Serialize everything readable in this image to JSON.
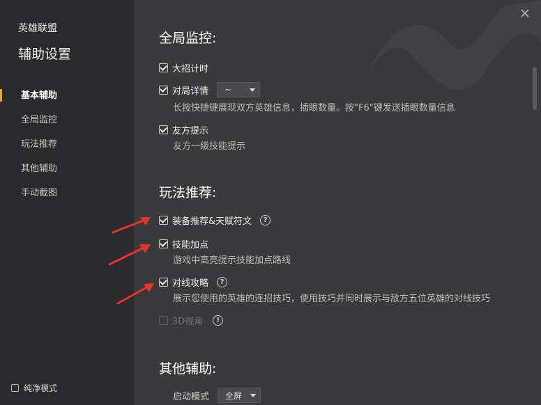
{
  "sidebar": {
    "app_name": "英雄联盟",
    "page_title": "辅助设置",
    "items": [
      {
        "label": "基本辅助",
        "active": true
      },
      {
        "label": "全局监控"
      },
      {
        "label": "玩法推荐"
      },
      {
        "label": "其他辅助"
      },
      {
        "label": "手动截图"
      }
    ],
    "pure_mode_label": "纯净模式",
    "accent_color": "#f2a21a"
  },
  "sections": {
    "global_monitor": {
      "title": "全局监控:",
      "ult_timer": {
        "label": "大招计时",
        "checked": true
      },
      "match_detail": {
        "label": "对局详情",
        "checked": true,
        "dropdown_value": "~",
        "desc": "长按快捷键展现双方英雄信息，插眼数量。按\"F6\"键发送插眼数量信息"
      },
      "ally_hint": {
        "label": "友方提示",
        "checked": true,
        "desc": "友方一级技能提示"
      }
    },
    "gameplay": {
      "title": "玩法推荐:",
      "equip_rune": {
        "label": "装备推荐&天赋符文",
        "checked": true,
        "help": "?"
      },
      "skill_points": {
        "label": "技能加点",
        "checked": true,
        "desc": "游戏中高亮提示技能加点路线"
      },
      "lane_guide": {
        "label": "对线攻略",
        "checked": true,
        "help": "?",
        "desc": "展示您使用的英雄的连招技巧，使用技巧并同时展示与敌方五位英雄的对线技巧"
      },
      "view_3d": {
        "label": "3D视角",
        "checked": false,
        "disabled": true,
        "info": "!"
      }
    },
    "other": {
      "title": "其他辅助:",
      "partial_row_label": "启动模式",
      "partial_dropdown": "全屏"
    }
  },
  "annotation_color": "#e8322b"
}
